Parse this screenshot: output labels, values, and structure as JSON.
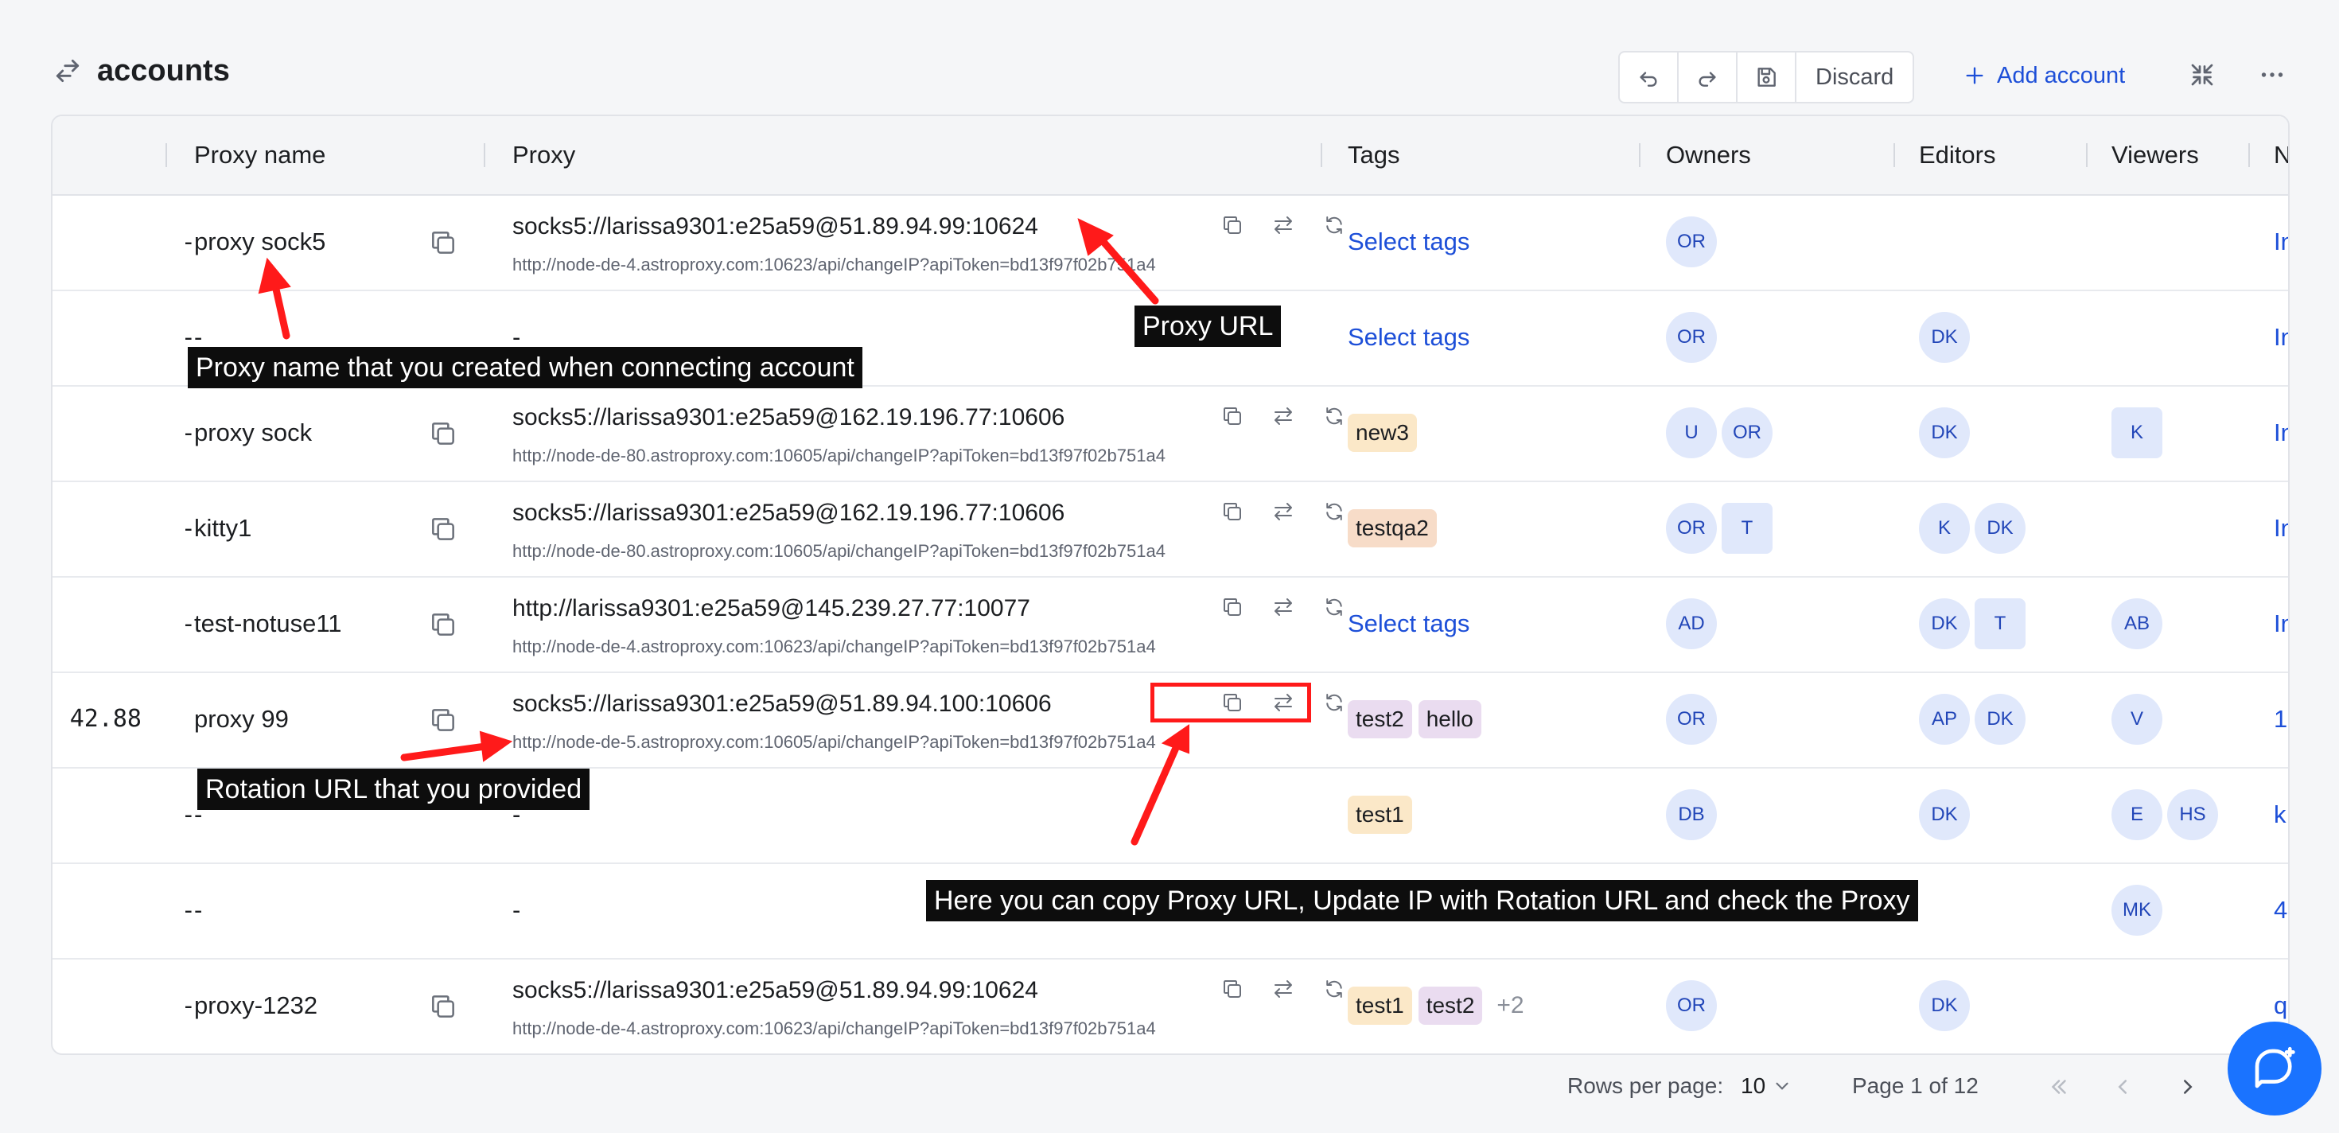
{
  "header": {
    "title": "accounts",
    "discard_label": "Discard",
    "add_account_label": "Add account"
  },
  "columns": {
    "proxy_name": "Proxy name",
    "proxy": "Proxy",
    "tags": "Tags",
    "owners": "Owners",
    "editors": "Editors",
    "viewers": "Viewers",
    "next": "N"
  },
  "rows": [
    {
      "num": "-",
      "name": "proxy sock5",
      "proxy": "socks5://larissa9301:e25a59@51.89.94.99:10624",
      "rotation": "http://node-de-4.astroproxy.com:10623/api/changeIP?apiToken=bd13f97f02b751a4",
      "select_tags": "Select tags",
      "owners": [
        "OR"
      ],
      "editors": [],
      "viewers": [],
      "next": "In"
    },
    {
      "num": "-",
      "name": "-",
      "proxy": "-",
      "select_tags": "Select tags",
      "owners": [
        "OR"
      ],
      "editors": [
        "DK"
      ],
      "viewers": [],
      "next": "In"
    },
    {
      "num": "-",
      "name": "proxy sock",
      "proxy": "socks5://larissa9301:e25a59@162.19.196.77:10606",
      "rotation": "http://node-de-80.astroproxy.com:10605/api/changeIP?apiToken=bd13f97f02b751a4",
      "tags": [
        "new3"
      ],
      "owners": [
        "U",
        "OR"
      ],
      "editors": [
        "DK"
      ],
      "viewers": [
        "K"
      ],
      "next": "In"
    },
    {
      "num": "-",
      "name": "kitty1",
      "proxy": "socks5://larissa9301:e25a59@162.19.196.77:10606",
      "rotation": "http://node-de-80.astroproxy.com:10605/api/changeIP?apiToken=bd13f97f02b751a4",
      "tags": [
        "testqa2"
      ],
      "owners": [
        "OR",
        "T"
      ],
      "editors": [
        "K",
        "DK"
      ],
      "viewers": [],
      "next": "In"
    },
    {
      "num": "-",
      "name": "test-notuse11",
      "proxy": "http://larissa9301:e25a59@145.239.27.77:10077",
      "rotation": "http://node-de-4.astroproxy.com:10623/api/changeIP?apiToken=bd13f97f02b751a4",
      "select_tags": "Select tags",
      "owners": [
        "AD"
      ],
      "editors": [
        "DK",
        "T"
      ],
      "viewers": [
        "AB"
      ],
      "next": "In"
    },
    {
      "num": "42.88",
      "name": "proxy 99",
      "proxy": "socks5://larissa9301:e25a59@51.89.94.100:10606",
      "rotation": "http://node-de-5.astroproxy.com:10605/api/changeIP?apiToken=bd13f97f02b751a4",
      "tags": [
        "test2",
        "hello"
      ],
      "owners": [
        "OR"
      ],
      "editors": [
        "AP",
        "DK"
      ],
      "viewers": [
        "V"
      ],
      "next": "1"
    },
    {
      "num": "-",
      "name": "-",
      "proxy": "-",
      "tags": [
        "test1"
      ],
      "owners": [
        "DB"
      ],
      "editors": [
        "DK"
      ],
      "viewers": [
        "E",
        "HS"
      ],
      "next": "k"
    },
    {
      "num": "-",
      "name": "-",
      "proxy": "-",
      "owners": [],
      "editors": [],
      "viewers": [
        "MK"
      ],
      "next": "4"
    },
    {
      "num": "-",
      "name": "proxy-1232",
      "proxy": "socks5://larissa9301:e25a59@51.89.94.99:10624",
      "rotation": "http://node-de-4.astroproxy.com:10623/api/changeIP?apiToken=bd13f97f02b751a4",
      "tags": [
        "test1",
        "test2"
      ],
      "tags_more": "+2",
      "owners": [
        "OR"
      ],
      "editors": [
        "DK"
      ],
      "viewers": [],
      "next": "q"
    }
  ],
  "tag_colors": {
    "new3": "#fbe8c8",
    "testqa2": "#f7dcc8",
    "test2": "#eadcf0",
    "hello": "#eadcf0",
    "test1": "#fbe8c8"
  },
  "footer": {
    "rows_per_page_label": "Rows per page:",
    "rows_per_page_value": "10",
    "page_label": "Page 1 of 12"
  },
  "annotations": {
    "proxy_name_note": "Proxy name that you created when connecting account",
    "proxy_url_note": "Proxy URL",
    "rotation_note": "Rotation URL that you provided",
    "actions_note": "Here you can copy Proxy URL, Update IP with Rotation URL and check the Proxy"
  },
  "colors": {
    "accent": "#1d4fd8",
    "annotation_red": "#ff1a1a",
    "chat_blue": "#1a73ff"
  }
}
